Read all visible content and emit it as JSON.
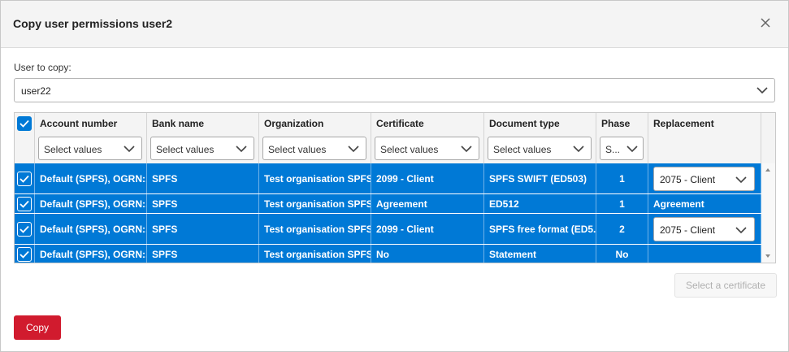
{
  "dialog": {
    "title": "Copy user permissions user2",
    "user_label": "User to copy:",
    "user_value": "user22",
    "select_cert_label": "Select a certificate",
    "copy_label": "Copy"
  },
  "grid": {
    "columns": [
      "Account number",
      "Bank name",
      "Organization",
      "Certificate",
      "Document type",
      "Phase",
      "Replacement"
    ],
    "filter_placeholder": "Select values",
    "filter_short": "S...",
    "rows": [
      {
        "account": "Default (SPFS), OGRN:...",
        "bank": "SPFS",
        "org": "Test organisation SPFS",
        "cert": "2099 - Client",
        "doc": "SPFS SWIFT (ED503)",
        "phase": "1",
        "replacement": "2075 - Client"
      },
      {
        "account": "Default (SPFS), OGRN:...",
        "bank": "SPFS",
        "org": "Test organisation SPFS",
        "cert": "Agreement",
        "doc": "ED512",
        "phase": "1",
        "replacement": "Agreement"
      },
      {
        "account": "Default (SPFS), OGRN:...",
        "bank": "SPFS",
        "org": "Test organisation SPFS",
        "cert": "2099 - Client",
        "doc": "SPFS free format (ED5...",
        "phase": "2",
        "replacement": "2075 - Client"
      },
      {
        "account": "Default (SPFS), OGRN:...",
        "bank": "SPFS",
        "org": "Test organisation SPFS",
        "cert": "No",
        "doc": "Statement",
        "phase": "No",
        "replacement": ""
      }
    ]
  },
  "colors": {
    "accent": "#0079d6",
    "danger": "#d11b2e"
  },
  "icons": {
    "close": "close-icon",
    "chevron": "chevron-down-icon",
    "check": "check-icon"
  }
}
